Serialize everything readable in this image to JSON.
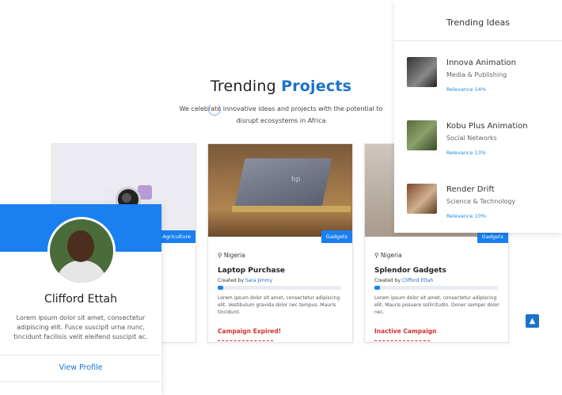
{
  "heading": {
    "text": "Trending ",
    "accent": "Projects",
    "subtitle": "We celebrate innovative ideas and projects with the potential to disrupt ecosystems in Africa"
  },
  "projects": [
    {
      "tag": "Agriculture"
    },
    {
      "tag": "Gadgets",
      "location": "Nigeria",
      "title": "Laptop Purchase",
      "created_by_label": "Created by",
      "creator": "Sara Jimmy",
      "desc": "Lorem ipsum dolor sit amet, consectetur adipiscing elit. Vestibulum gravida dolor nec tempus. Mauris tincidunt.",
      "status": "Campaign Expired!",
      "progress_pct": 4
    },
    {
      "tag": "Gadgets",
      "location": "Nigeria",
      "title": "Splendor Gadgets",
      "created_by_label": "Created by",
      "creator": "Clifford Ettah",
      "desc": "Lorem ipsum dolor sit amet, consectetur adipiscing elit. Mauris posuere sollicitudin. Donec semper dolor nec.",
      "status": "Inactive Campaign",
      "progress_pct": 4
    }
  ],
  "profile": {
    "name": "Clifford Ettah",
    "bio": "Lorem ipsum dolor sit amet, consectetur adipiscing elit. Fusce suscipit urna nunc, tincidunt facilisis velit eleifend suscipit ac.",
    "button": "View Profile"
  },
  "ideas": {
    "title": "Trending Ideas",
    "items": [
      {
        "name": "Innova Animation",
        "category": "Media & Publishing",
        "relevance": "Relevance 14%"
      },
      {
        "name": "Kobu Plus Animation",
        "category": "Social Networks",
        "relevance": "Relevance 13%"
      },
      {
        "name": "Render Drift",
        "category": "Science & Technology",
        "relevance": "Relevance 10%"
      }
    ]
  },
  "icons": {
    "location": "map-pin-icon",
    "scroll_top": "chevron-up-icon"
  },
  "colors": {
    "accent": "#1a7ff0",
    "danger": "#d32f2f"
  }
}
